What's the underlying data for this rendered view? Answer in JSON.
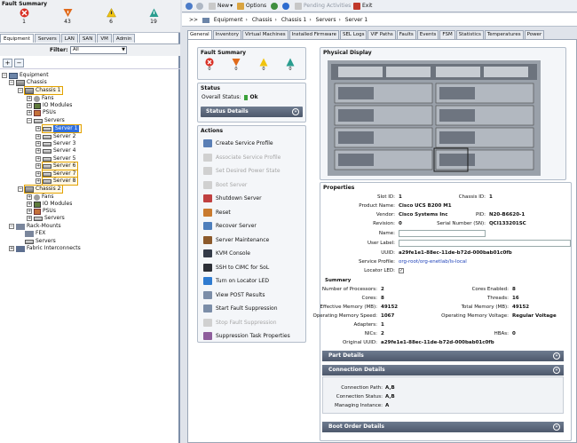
{
  "fault_summary": {
    "title": "Fault Summary",
    "critical": "1",
    "major": "43",
    "minor": "6",
    "warning": "19"
  },
  "nav_tabs": [
    "Equipment",
    "Servers",
    "LAN",
    "SAN",
    "VM",
    "Admin"
  ],
  "filter": {
    "label": "Filter:",
    "value": "All"
  },
  "tree": {
    "equipment": "Equipment",
    "chassis": "Chassis",
    "chassis1": "Chassis 1",
    "fans": "Fans",
    "io_modules": "IO Modules",
    "psus": "PSUs",
    "servers": "Servers",
    "server_list": [
      "Server 1",
      "Server 2",
      "Server 3",
      "Server 4",
      "Server 5",
      "Server 6",
      "Server 7",
      "Server 8"
    ],
    "chassis2": "Chassis 2",
    "fans2": "Fans",
    "io_modules2": "IO Modules",
    "psus2": "PSUs",
    "servers2": "Servers",
    "rack_mounts": "Rack-Mounts",
    "fex": "FEX",
    "rack_servers": "Servers",
    "fabric": "Fabric Interconnects"
  },
  "toolbar": {
    "new": "New",
    "options": "Options",
    "pending": "Pending Activities",
    "exit": "Exit"
  },
  "breadcrumb": {
    "prefix": ">>",
    "items": [
      "Equipment",
      "Chassis",
      "Chassis 1",
      "Servers",
      "Server 1"
    ]
  },
  "tabs": [
    "General",
    "Inventory",
    "Virtual Machines",
    "Installed Firmware",
    "SEL Logs",
    "VIF Paths",
    "Faults",
    "Events",
    "FSM",
    "Statistics",
    "Temperatures",
    "Power"
  ],
  "fault_box": {
    "title": "Fault Summary",
    "critical": "0",
    "major": "0",
    "minor": "0",
    "warning": "0"
  },
  "status": {
    "title": "Status",
    "overall_label": "Overall Status:",
    "overall_value": "Ok",
    "details": "Status Details"
  },
  "actions": {
    "title": "Actions",
    "items": [
      {
        "label": "Create Service Profile",
        "enabled": true
      },
      {
        "label": "Associate Service Profile",
        "enabled": false
      },
      {
        "label": "Set Desired Power State",
        "enabled": false
      },
      {
        "label": "Boot Server",
        "enabled": false
      },
      {
        "label": "Shutdown Server",
        "enabled": true
      },
      {
        "label": "Reset",
        "enabled": true
      },
      {
        "label": "Recover Server",
        "enabled": true
      },
      {
        "label": "Server Maintenance",
        "enabled": true
      },
      {
        "label": "KVM Console",
        "enabled": true
      },
      {
        "label": "SSH to CIMC for SoL",
        "enabled": true
      },
      {
        "label": "Turn on Locator LED",
        "enabled": true
      },
      {
        "label": "View POST Results",
        "enabled": true
      },
      {
        "label": "Start Fault Suppression",
        "enabled": true
      },
      {
        "label": "Stop Fault Suppression",
        "enabled": false
      },
      {
        "label": "Suppression Task Properties",
        "enabled": true
      }
    ]
  },
  "physical_display": {
    "title": "Physical Display"
  },
  "properties": {
    "title": "Properties",
    "slot_id_label": "Slot ID:",
    "slot_id": "1",
    "chassis_id_label": "Chassis ID:",
    "chassis_id": "1",
    "product_name_label": "Product Name:",
    "product_name": "Cisco UCS B200 M1",
    "vendor_label": "Vendor:",
    "vendor": "Cisco Systems Inc",
    "pid_label": "PID:",
    "pid": "N20-B6620-1",
    "revision_label": "Revision:",
    "revision": "0",
    "serial_label": "Serial Number (SN):",
    "serial": "QCI133201SC",
    "name_label": "Name:",
    "user_label_label": "User Label:",
    "uuid_label": "UUID:",
    "uuid": "a29fe1e1-88ec-11de-b72d-000bab01c0fb",
    "service_profile_label": "Service Profile:",
    "service_profile": "org-root/org-enetlab/ls-local",
    "locator_led_label": "Locator LED:",
    "summary_title": "Summary",
    "processors_label": "Number of Processors:",
    "processors": "2",
    "cores_enabled_label": "Cores Enabled:",
    "cores_enabled": "8",
    "cores_label": "Cores:",
    "cores": "8",
    "threads_label": "Threads:",
    "threads": "16",
    "eff_mem_label": "Effective Memory (MB):",
    "eff_mem": "49152",
    "total_mem_label": "Total Memory (MB):",
    "total_mem": "49152",
    "op_mem_speed_label": "Operating Memory Speed:",
    "op_mem_speed": "1067",
    "op_mem_volt_label": "Operating Memory Voltage:",
    "op_mem_volt": "Regular Voltage",
    "adapters_label": "Adapters:",
    "adapters": "1",
    "nics_label": "NICs:",
    "nics": "2",
    "hbas_label": "HBAs:",
    "hbas": "0",
    "orig_uuid_label": "Original UUID:",
    "orig_uuid": "a29fe1e1-88ec-11de-b72d-000bab01c0fb"
  },
  "part_details": "Part Details",
  "connection_details": {
    "title": "Connection Details",
    "path_label": "Connection Path:",
    "path": "A,B",
    "status_label": "Connection Status:",
    "status": "A,B",
    "mgmt_label": "Managing Instance:",
    "mgmt": "A"
  },
  "boot_order": "Boot Order Details",
  "colors": {
    "critical": "#d93025",
    "major": "#e06a1b",
    "minor": "#f1c40f",
    "warning": "#2a9d8f",
    "header_bar": "#5a6578",
    "highlight": "#2f6fe0",
    "link": "#1b3fb8"
  }
}
